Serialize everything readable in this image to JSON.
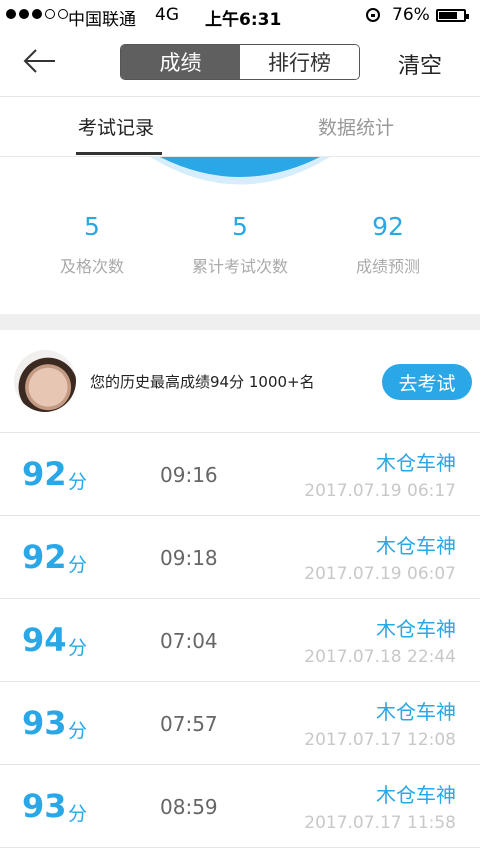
{
  "status_bar": {
    "carrier": "中国联通",
    "network": "4G",
    "time": "上午6:31",
    "battery": "76%",
    "battery_level": 0.76
  },
  "nav": {
    "segments": [
      "成绩",
      "排行榜"
    ],
    "active_segment": "成绩",
    "clear_label": "清空"
  },
  "tabs": [
    "考试记录",
    "数据统计"
  ],
  "stats": [
    {
      "value": "5",
      "label": "及格次数"
    },
    {
      "value": "5",
      "label": "累计考试次数"
    },
    {
      "value": "92",
      "label": "成绩预测"
    }
  ],
  "best": {
    "text": "您的历史最高成绩94分  1000+名",
    "button": "去考试"
  },
  "records": [
    {
      "score": "92",
      "unit": "分",
      "duration": "09:16",
      "title": "木仓车神",
      "date": "2017.07.19 06:17"
    },
    {
      "score": "92",
      "unit": "分",
      "duration": "09:18",
      "title": "木仓车神",
      "date": "2017.07.19 06:07"
    },
    {
      "score": "94",
      "unit": "分",
      "duration": "07:04",
      "title": "木仓车神",
      "date": "2017.07.18 22:44"
    },
    {
      "score": "93",
      "unit": "分",
      "duration": "07:57",
      "title": "木仓车神",
      "date": "2017.07.17 12:08"
    },
    {
      "score": "93",
      "unit": "分",
      "duration": "08:59",
      "title": "木仓车神",
      "date": "2017.07.17 11:58"
    }
  ],
  "colors": {
    "accent": "#2aa7e6",
    "segment_active": "#5f5f5f",
    "muted": "#c8c8c8"
  }
}
